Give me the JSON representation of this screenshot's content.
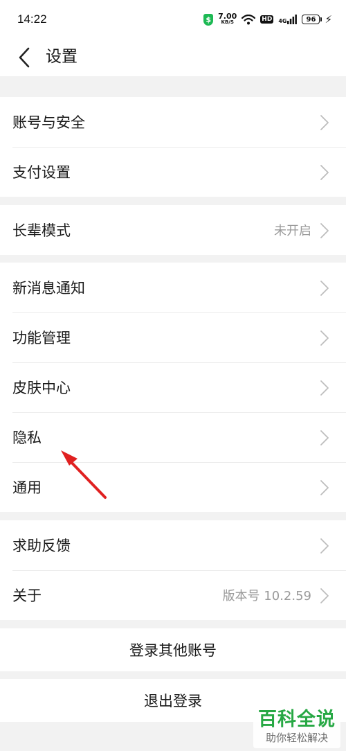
{
  "status_bar": {
    "time": "14:22",
    "speed_value": "7.00",
    "speed_unit": "KB/S",
    "hd_label": "HD",
    "network_label": "4G",
    "battery": "96",
    "icons": [
      "shield-icon",
      "wifi-icon",
      "signal-icon",
      "battery-icon",
      "charging-icon"
    ]
  },
  "header": {
    "title": "设置",
    "back_icon": "chevron-left-icon"
  },
  "groups": [
    {
      "items": [
        {
          "label": "账号与安全"
        },
        {
          "label": "支付设置"
        }
      ]
    },
    {
      "items": [
        {
          "label": "长辈模式",
          "value": "未开启"
        }
      ]
    },
    {
      "items": [
        {
          "label": "新消息通知"
        },
        {
          "label": "功能管理"
        },
        {
          "label": "皮肤中心"
        },
        {
          "label": "隐私"
        },
        {
          "label": "通用"
        }
      ]
    },
    {
      "items": [
        {
          "label": "求助反馈"
        },
        {
          "label": "关于",
          "value": "版本号 10.2.59"
        }
      ]
    }
  ],
  "actions": {
    "switch_account": "登录其他账号",
    "logout": "退出登录"
  },
  "annotation": {
    "arrow_color": "#e02020",
    "target": "隐私"
  },
  "watermark": {
    "main": "百科全说",
    "sub": "助你轻松解决",
    "color": "#27a844"
  }
}
